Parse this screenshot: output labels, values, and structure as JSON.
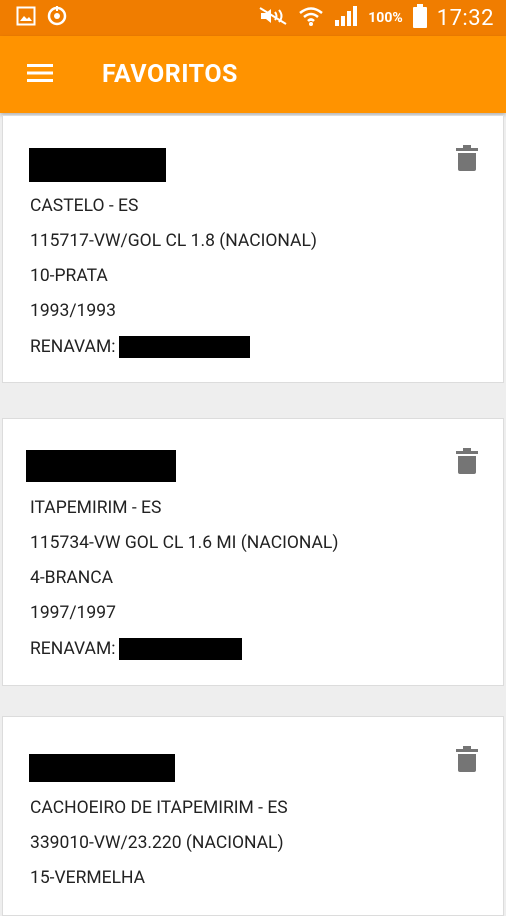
{
  "status_bar": {
    "battery_percent": "100%",
    "time": "17:32",
    "icons": [
      "gallery-icon",
      "sync-icon",
      "mute-icon",
      "wifi-icon",
      "signal-icon",
      "battery-icon"
    ]
  },
  "app_bar": {
    "title": "FAVORITOS",
    "menu_icon": "menu-icon"
  },
  "colors": {
    "status_bar": "#f07d00",
    "app_bar": "#ff9300",
    "background": "#eeeeee",
    "card": "#ffffff",
    "text": "#222222",
    "delete_icon": "#757575"
  },
  "favorites": [
    {
      "city": "CASTELO - ES",
      "model": "115717-VW/GOL CL 1.8 (NACIONAL)",
      "color": "10-PRATA",
      "year": "1993/1993",
      "renavam_label": "RENAVAM:"
    },
    {
      "city": "ITAPEMIRIM - ES",
      "model": "115734-VW GOL CL 1.6 MI (NACIONAL)",
      "color": "4-BRANCA",
      "year": "1997/1997",
      "renavam_label": "RENAVAM:"
    },
    {
      "city": "CACHOEIRO DE ITAPEMIRIM - ES",
      "model": "339010-VW/23.220 (NACIONAL)",
      "color": "15-VERMELHA",
      "year": "",
      "renavam_label": ""
    }
  ]
}
